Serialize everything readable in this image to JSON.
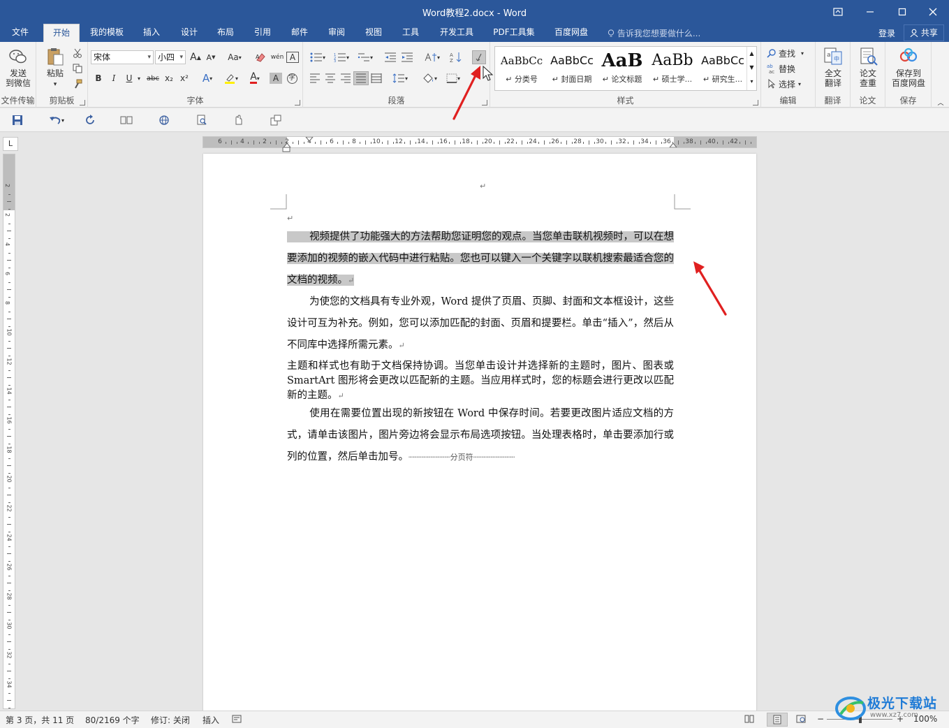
{
  "titlebar": {
    "title": "Word教程2.docx - Word"
  },
  "tabs": {
    "file": "文件",
    "home": "开始",
    "mytemplate": "我的模板",
    "insert": "插入",
    "design": "设计",
    "layout": "布局",
    "references": "引用",
    "mailings": "邮件",
    "review": "审阅",
    "view": "视图",
    "tools": "工具",
    "developer": "开发工具",
    "pdf": "PDF工具集",
    "baidu": "百度网盘",
    "tellme": "告诉我您想要做什么...",
    "login": "登录",
    "share": "共享"
  },
  "ribbon": {
    "wechat": {
      "label1": "发送",
      "label2": "到微信",
      "group": "文件传输"
    },
    "clipboard": {
      "paste": "粘贴",
      "group": "剪贴板"
    },
    "font": {
      "name": "宋体",
      "size": "小四",
      "group": "字体",
      "grow": "A",
      "shrink": "A",
      "case": "Aa",
      "bold": "B",
      "italic": "I",
      "underline": "U",
      "strike": "abc",
      "sub": "x₂",
      "sup": "x²",
      "pinyin": "wén",
      "border": "A",
      "effects": "A",
      "color": "A",
      "shade": "A",
      "circle": "字"
    },
    "paragraph": {
      "group": "段落"
    },
    "styles": {
      "group": "样式",
      "items": [
        {
          "sample": "AaBbCc",
          "name": "↵ 分类号"
        },
        {
          "sample": "AaBbCc",
          "name": "↵ 封面日期"
        },
        {
          "sample": "AaB",
          "name": "↵ 论文标题"
        },
        {
          "sample": "AaBb",
          "name": "↵ 硕士学..."
        },
        {
          "sample": "AaBbCc",
          "name": "↵ 研究生..."
        }
      ]
    },
    "editing": {
      "find": "查找",
      "replace": "替换",
      "select": "选择",
      "group": "编辑"
    },
    "translate": {
      "label1": "全文",
      "label2": "翻译",
      "group": "翻译"
    },
    "paper": {
      "label1": "论文",
      "label2": "查重",
      "group": "论文"
    },
    "save": {
      "label1": "保存到",
      "label2": "百度网盘",
      "group": "保存"
    }
  },
  "ruler": {
    "h_ticks": [
      "6",
      "4",
      "2",
      "2",
      "4",
      "6",
      "8",
      "10",
      "12",
      "14",
      "16",
      "18",
      "20",
      "22",
      "24",
      "26",
      "28",
      "30",
      "32",
      "34",
      "36",
      "38",
      "40",
      "42"
    ],
    "v_ticks": [
      "2",
      "2",
      "4",
      "6",
      "8",
      "10",
      "12",
      "14",
      "16",
      "18",
      "20",
      "22",
      "24",
      "26",
      "28",
      "30",
      "32",
      "34"
    ]
  },
  "document": {
    "top_mark": "↵",
    "empty_mark": "↵",
    "p1": "视频提供了功能强大的方法帮助您证明您的观点。当您单击联机视频时，可以在想要添加的视频的嵌入代码中进行粘贴。您也可以键入一个关键字以联机搜索最适合您的文档的视频。",
    "p2": "为使您的文档具有专业外观，Word 提供了页眉、页脚、封面和文本框设计，这些设计可互为补充。例如，您可以添加匹配的封面、页眉和提要栏。单击“插入”，然后从不同库中选择所需元素。",
    "p3": "主题和样式也有助于文档保持协调。当您单击设计并选择新的主题时，图片、图表或 SmartArt 图形将会更改以匹配新的主题。当应用样式时，您的标题会进行更改以匹配新的主题。",
    "p4": "使用在需要位置出现的新按钮在 Word 中保存时间。若要更改图片适应文档的方式，请单击该图片，图片旁边将会显示布局选项按钮。当处理表格时，单击要添加行或列的位置，然后单击加号。",
    "para_mark": "↵",
    "page_break": "分页符"
  },
  "statusbar": {
    "page": "第 3 页，共 11 页",
    "words": "80/2169 个字",
    "track": "修订: 关闭",
    "insert": "插入",
    "zoom": "100%"
  },
  "watermark": {
    "text": "极光下载站",
    "url": "www.xz7.com"
  },
  "colors": {
    "accent": "#2b579a",
    "ribbon": "#f3f3f3",
    "arrow": "#e02020",
    "selection": "#c8c8c8"
  }
}
